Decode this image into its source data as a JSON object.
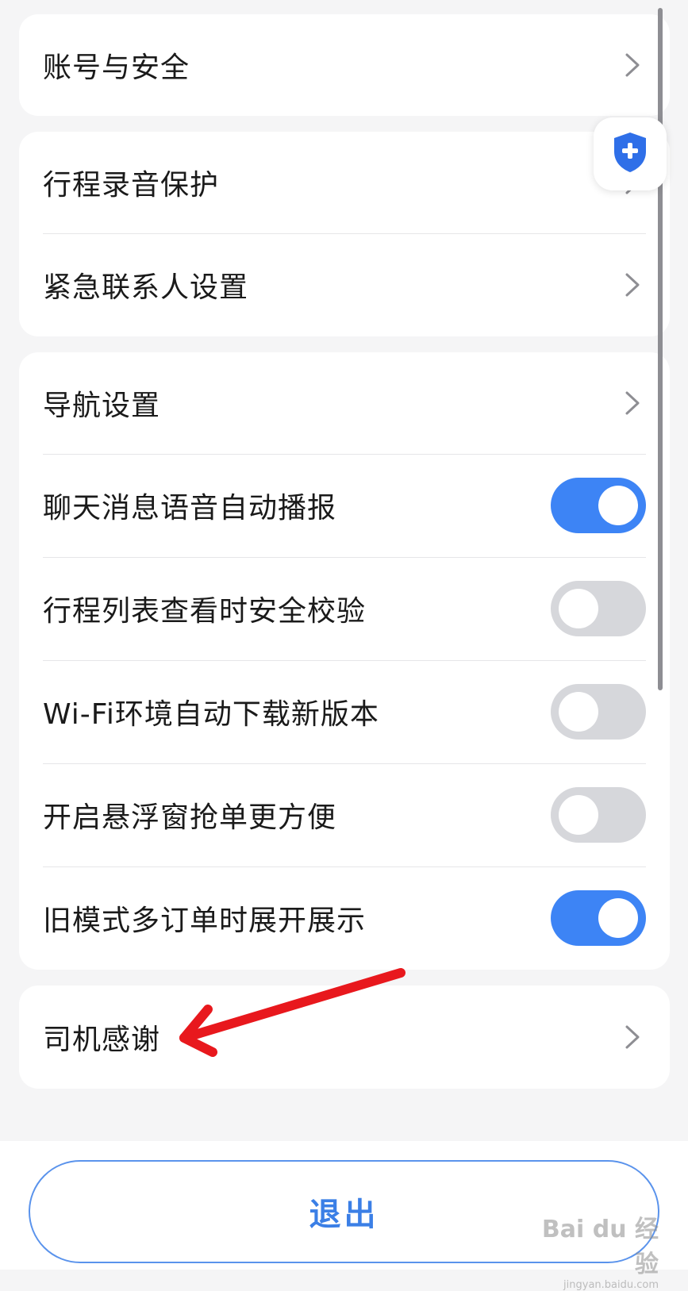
{
  "groups": {
    "account": {
      "items": [
        {
          "label": "账号与安全",
          "control": "chevron"
        }
      ]
    },
    "safety": {
      "items": [
        {
          "label": "行程录音保护",
          "control": "chevron"
        },
        {
          "label": "紧急联系人设置",
          "control": "chevron"
        }
      ]
    },
    "preferences": {
      "items": [
        {
          "label": "导航设置",
          "control": "chevron"
        },
        {
          "label": "聊天消息语音自动播报",
          "control": "toggle",
          "on": true
        },
        {
          "label": "行程列表查看时安全校验",
          "control": "toggle",
          "on": false
        },
        {
          "label": "Wi-Fi环境自动下载新版本",
          "control": "toggle",
          "on": false
        },
        {
          "label": "开启悬浮窗抢单更方便",
          "control": "toggle",
          "on": false
        },
        {
          "label": "旧模式多订单时展开展示",
          "control": "toggle",
          "on": true
        }
      ]
    },
    "thanks": {
      "items": [
        {
          "label": "司机感谢",
          "control": "chevron"
        }
      ]
    }
  },
  "logout": {
    "label": "退出"
  },
  "floating_badge": {
    "icon": "shield-plus-icon",
    "color": "#2f6fe8"
  },
  "annotation": {
    "type": "red-arrow",
    "color": "#e8181d",
    "points_to": "司机感谢"
  },
  "watermark": {
    "main": "Bai du 经验",
    "sub": "jingyan.baidu.com"
  },
  "colors": {
    "accent": "#3d84f5",
    "toggle_off": "#d6d7db",
    "background": "#f5f5f6"
  }
}
